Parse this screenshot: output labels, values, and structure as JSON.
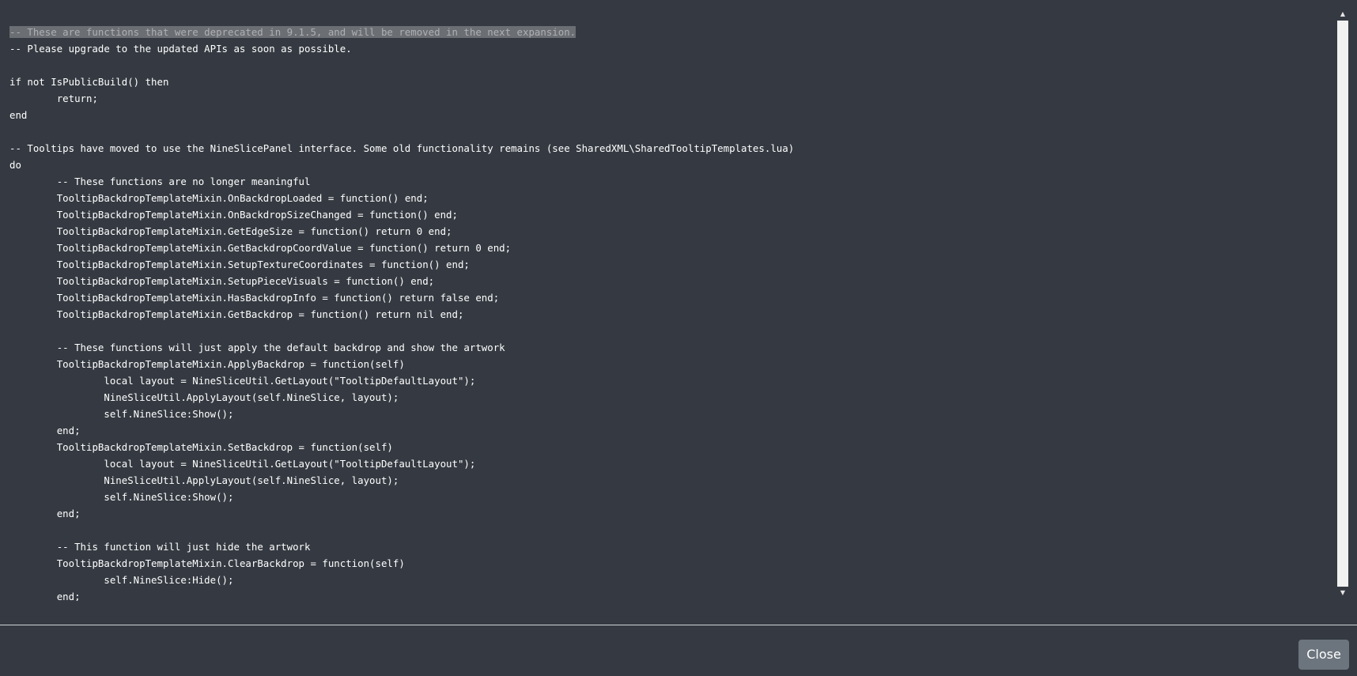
{
  "code": {
    "lines": [
      "-- These are functions that were deprecated in 9.1.5, and will be removed in the next expansion.",
      "-- Please upgrade to the updated APIs as soon as possible.",
      "",
      "if not IsPublicBuild() then",
      "\treturn;",
      "end",
      "",
      "-- Tooltips have moved to use the NineSlicePanel interface. Some old functionality remains (see SharedXML\\SharedTooltipTemplates.lua)",
      "do",
      "\t-- These functions are no longer meaningful",
      "\tTooltipBackdropTemplateMixin.OnBackdropLoaded = function() end;",
      "\tTooltipBackdropTemplateMixin.OnBackdropSizeChanged = function() end;",
      "\tTooltipBackdropTemplateMixin.GetEdgeSize = function() return 0 end;",
      "\tTooltipBackdropTemplateMixin.GetBackdropCoordValue = function() return 0 end;",
      "\tTooltipBackdropTemplateMixin.SetupTextureCoordinates = function() end;",
      "\tTooltipBackdropTemplateMixin.SetupPieceVisuals = function() end;",
      "\tTooltipBackdropTemplateMixin.HasBackdropInfo = function() return false end;",
      "\tTooltipBackdropTemplateMixin.GetBackdrop = function() return nil end;",
      "",
      "\t-- These functions will just apply the default backdrop and show the artwork",
      "\tTooltipBackdropTemplateMixin.ApplyBackdrop = function(self)",
      "\t\tlocal layout = NineSliceUtil.GetLayout(\"TooltipDefaultLayout\");",
      "\t\tNineSliceUtil.ApplyLayout(self.NineSlice, layout);",
      "\t\tself.NineSlice:Show();",
      "\tend;",
      "\tTooltipBackdropTemplateMixin.SetBackdrop = function(self)",
      "\t\tlocal layout = NineSliceUtil.GetLayout(\"TooltipDefaultLayout\");",
      "\t\tNineSliceUtil.ApplyLayout(self.NineSlice, layout);",
      "\t\tself.NineSlice:Show();",
      "\tend;",
      "",
      "\t-- This function will just hide the artwork",
      "\tTooltipBackdropTemplateMixin.ClearBackdrop = function(self)",
      "\t\tself.NineSlice:Hide();",
      "\tend;"
    ]
  },
  "footer": {
    "close_label": "Close"
  },
  "scrollbar": {
    "up_arrow": "▲",
    "down_arrow": "▼"
  },
  "colors": {
    "background": "#353a42",
    "text": "#ffffff",
    "selection": "#6b6e73",
    "button": "#6c757d"
  }
}
